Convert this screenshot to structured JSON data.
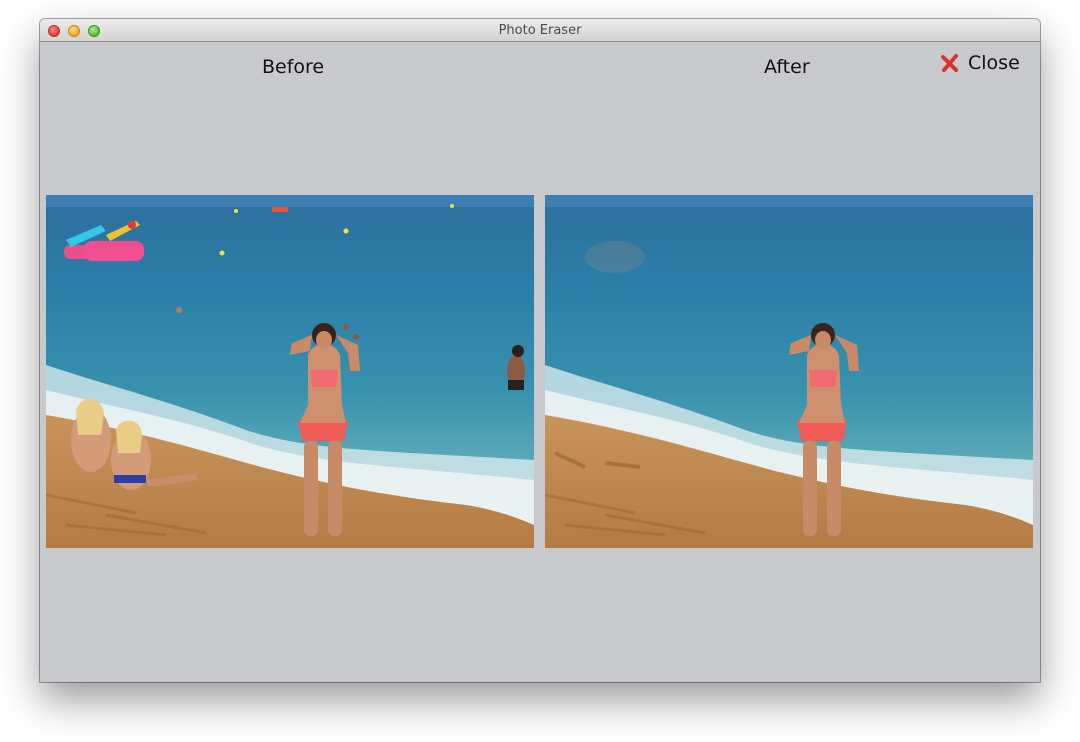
{
  "window": {
    "title": "Photo Eraser"
  },
  "panels": {
    "before_label": "Before",
    "after_label": "After"
  },
  "toolbar": {
    "close_label": "Close",
    "close_icon": "red-x-icon",
    "close_color": "#d9342b"
  }
}
